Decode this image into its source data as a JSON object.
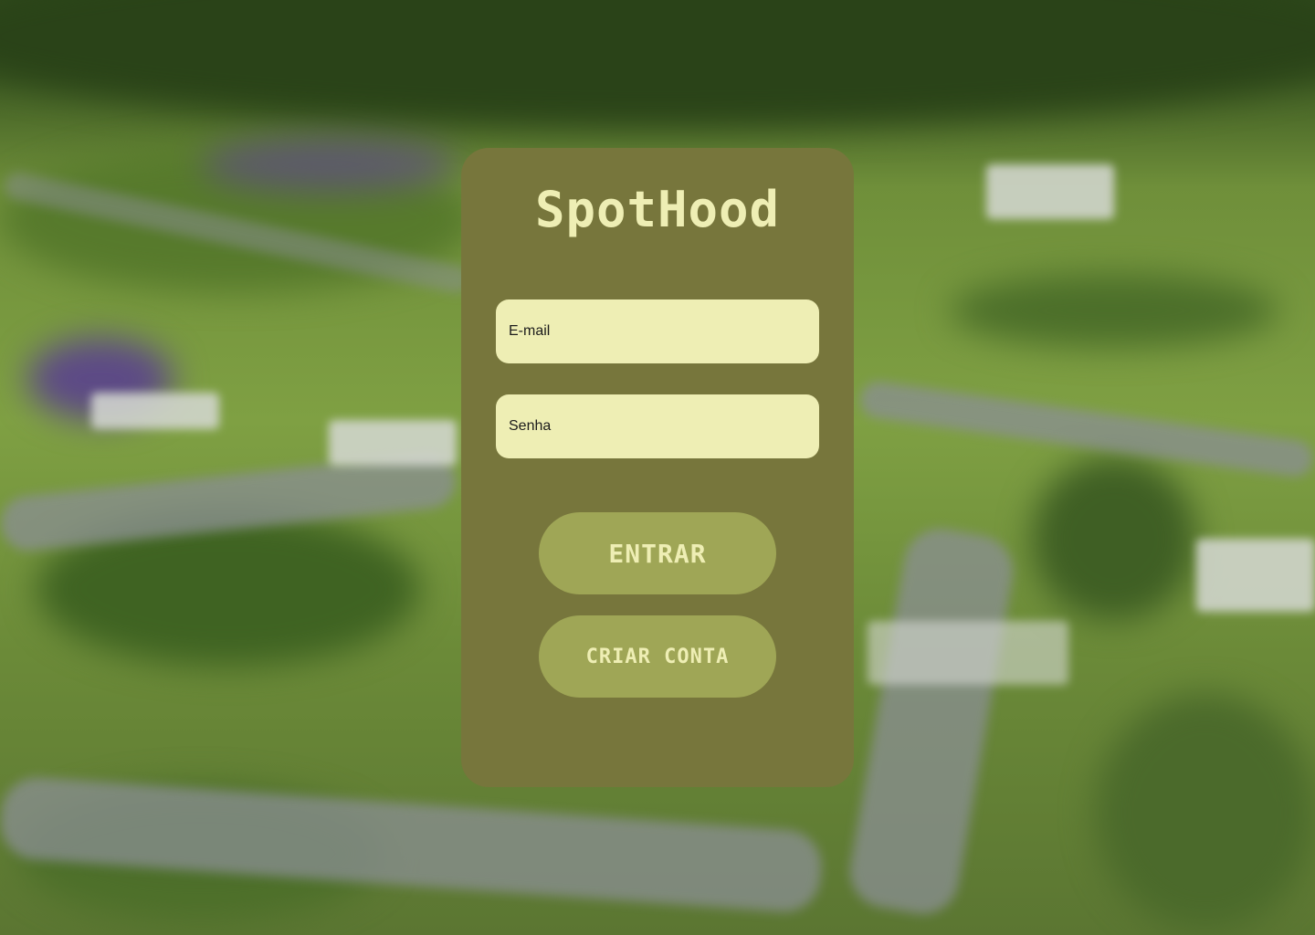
{
  "app": {
    "title": "SpotHood"
  },
  "login": {
    "email_placeholder": "E-mail",
    "password_placeholder": "Senha",
    "enter_label": "ENTRAR",
    "create_account_label": "CRIAR CONTA"
  },
  "colors": {
    "card": "#77763c",
    "field": "#eeeeb4",
    "button": "#9fa656",
    "brand_text": "#eeeeb4"
  }
}
